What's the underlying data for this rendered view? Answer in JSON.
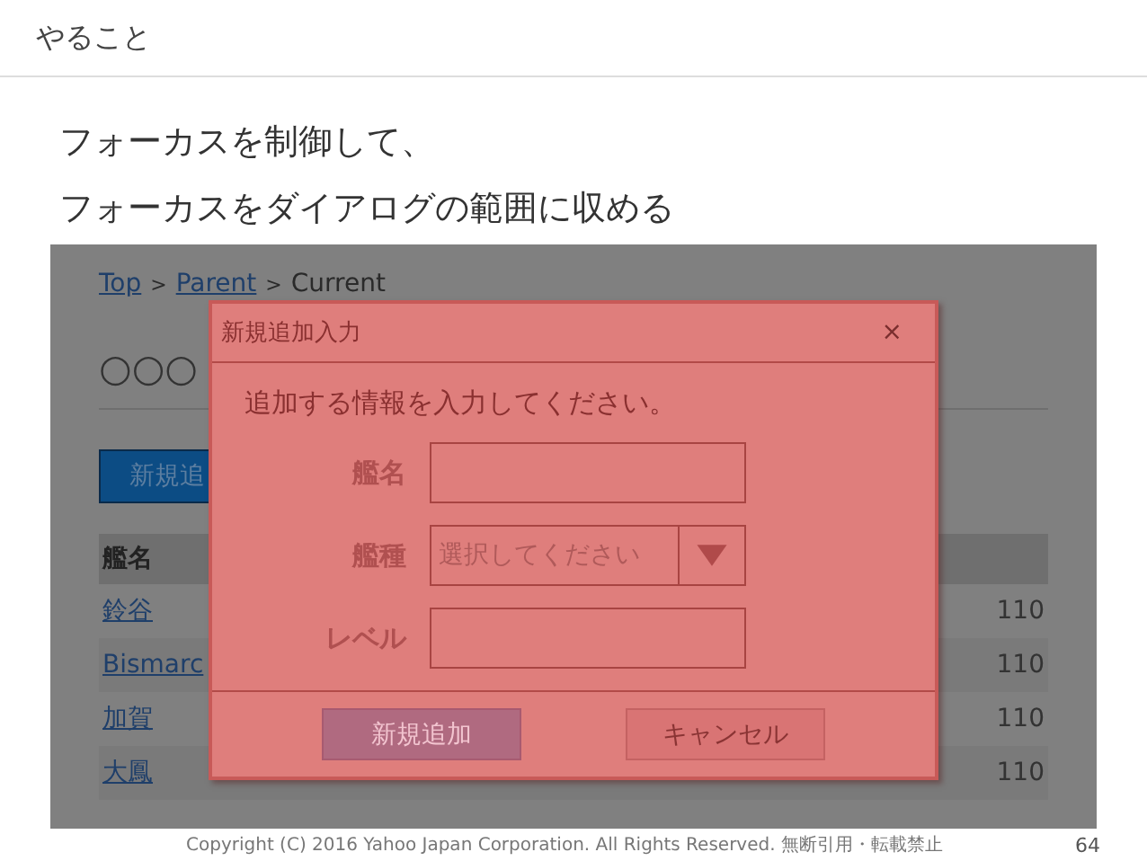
{
  "slide": {
    "title": "やること",
    "heading_lines": [
      "フォーカスを制御して、",
      "フォーカスをダイアログの範囲に収める"
    ],
    "copyright": "Copyright (C) 2016 Yahoo Japan Corporation. All Rights Reserved. 無断引用・転載禁止",
    "page_number": "64"
  },
  "screen": {
    "breadcrumb": [
      {
        "kind": "link",
        "text": "Top"
      },
      {
        "kind": "separator",
        "text": ">"
      },
      {
        "kind": "link",
        "text": "Parent"
      },
      {
        "kind": "separator",
        "text": ">"
      },
      {
        "kind": "current",
        "text": "Current"
      }
    ],
    "heading": "○○○",
    "add_button": "新規追",
    "table": {
      "columns": [
        "艦名"
      ],
      "rows": [
        {
          "name": "鈴谷",
          "value": "110"
        },
        {
          "name": "Bismarc",
          "value": "110"
        },
        {
          "name": "加賀",
          "value": "110"
        },
        {
          "name": "大鳳",
          "value": "110"
        }
      ]
    }
  },
  "dialog": {
    "title": "新規追加入力",
    "close": "×",
    "message": "追加する情報を入力してください。",
    "fields": [
      {
        "kind": "text",
        "label": "艦名"
      },
      {
        "kind": "select",
        "label": "艦種",
        "placeholder": "選択してください"
      },
      {
        "kind": "text",
        "label": "レベル"
      }
    ],
    "buttons": [
      {
        "kind": "primary",
        "label": "新規追加"
      },
      {
        "kind": "secondary",
        "label": "キャンセル"
      }
    ]
  }
}
